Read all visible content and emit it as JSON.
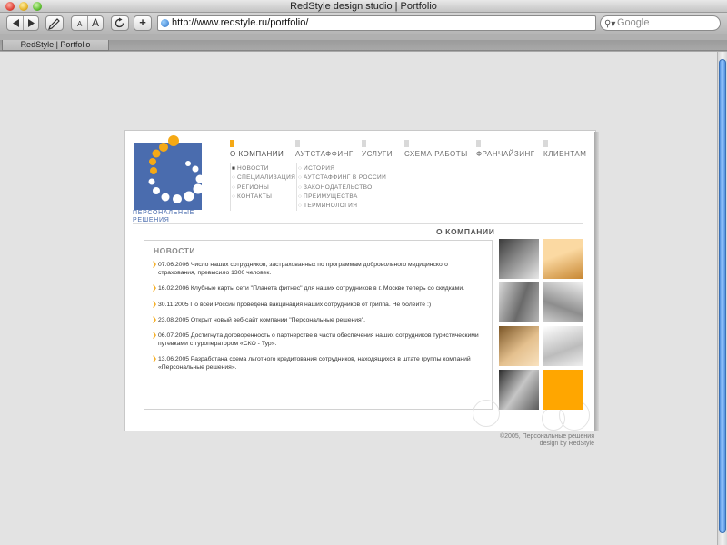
{
  "window": {
    "title": "RedStyle design studio | Portfolio"
  },
  "toolbar": {
    "back_icon": "back-arrow-icon",
    "forward_icon": "forward-arrow-icon",
    "edit_icon": "pencil-icon",
    "text_small_label": "A",
    "text_large_label": "A",
    "reload_icon": "reload-icon",
    "add_bookmark_label": "+",
    "url": "http://www.redstyle.ru/portfolio/",
    "search_placeholder": "Google"
  },
  "tabs": [
    {
      "label": "RedStyle | Portfolio"
    }
  ],
  "site": {
    "logo_text": "Персональные решения",
    "main_nav": [
      {
        "label": "О компании",
        "active": true
      },
      {
        "label": "Аутстаффинг",
        "active": false
      },
      {
        "label": "Услуги",
        "active": false
      },
      {
        "label": "Схема работы",
        "active": false
      },
      {
        "label": "Франчайзинг",
        "active": false
      },
      {
        "label": "Клиентам",
        "active": false
      }
    ],
    "subnav_left": [
      "Новости",
      "Специализация",
      "Регионы",
      "Контакты"
    ],
    "subnav_right": [
      "История",
      "Аутстаффинг в России",
      "Законодательство",
      "Преимущества",
      "Терминология"
    ],
    "section_title": "О компании",
    "news_heading": "Новости",
    "news": [
      {
        "text": "07.06.2006 Число наших сотрудников, застрахованных по программам добровольного медицинского страхования, превысило 1300 человек."
      },
      {
        "text": "16.02.2006 Клубные карты сети \"Планета фитнес\" для наших сотрудников в г. Москве теперь со скидками."
      },
      {
        "text": "30.11.2005 По всей России проведена вакцинация наших сотрудников от гриппа. Не болейте :)"
      },
      {
        "text": "23.08.2005 Открыт новый веб-сайт компании \"Персональные решения\"."
      },
      {
        "text": "06.07.2005 Достигнута договоренность о партнерстве в части обеспечения наших сотрудников туристическими путевками с туроператором «СКО - Тур»."
      },
      {
        "text": "13.06.2005 Разработана схема льготного кредитования сотрудников, находящихся в штате группы компаний «Персональные решения»."
      }
    ],
    "footer_copyright": "©2005, Персональные решения",
    "footer_credit": "design by RedStyle"
  },
  "colors": {
    "accent_orange": "#f5a915",
    "logo_blue": "#4a6cae"
  }
}
